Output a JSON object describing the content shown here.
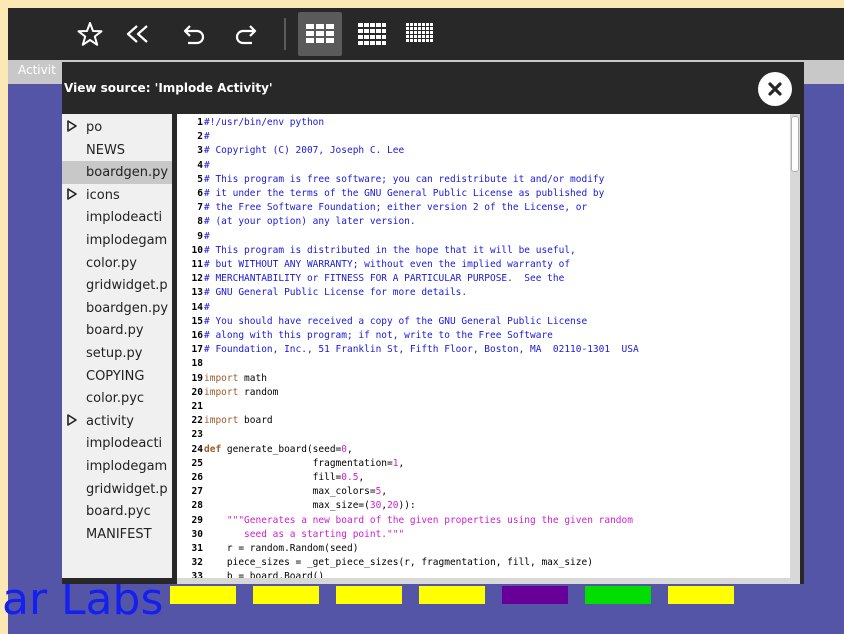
{
  "toolbar": {
    "buttons": [
      {
        "name": "star-icon",
        "label": "favorite"
      },
      {
        "name": "rewind-icon",
        "label": "rewind"
      },
      {
        "name": "undo-icon",
        "label": "undo"
      },
      {
        "name": "redo-icon",
        "label": "redo"
      },
      {
        "name": "grid-small-icon",
        "label": "small board",
        "active": true
      },
      {
        "name": "grid-medium-icon",
        "label": "medium board"
      },
      {
        "name": "grid-large-icon",
        "label": "large board"
      }
    ]
  },
  "background": {
    "activity_label": "Activit",
    "logo_text": "ar Labs",
    "tile_colors": [
      "#ffff00",
      "#ffff00",
      "#ffff00",
      "#ffff00",
      "#660099",
      "#00dd00",
      "#ffff00"
    ]
  },
  "dialog": {
    "title": "View source: 'Implode Activity'",
    "close_icon": "close-icon"
  },
  "files": [
    {
      "name": "po",
      "folder": true,
      "selected": false
    },
    {
      "name": "NEWS",
      "folder": false,
      "selected": false
    },
    {
      "name": "boardgen.py",
      "folder": false,
      "selected": true
    },
    {
      "name": "icons",
      "folder": true,
      "selected": false
    },
    {
      "name": "implodeacti",
      "folder": false,
      "selected": false
    },
    {
      "name": "implodegam",
      "folder": false,
      "selected": false
    },
    {
      "name": "color.py",
      "folder": false,
      "selected": false
    },
    {
      "name": "gridwidget.p",
      "folder": false,
      "selected": false
    },
    {
      "name": "boardgen.py",
      "folder": false,
      "selected": false
    },
    {
      "name": "board.py",
      "folder": false,
      "selected": false
    },
    {
      "name": "setup.py",
      "folder": false,
      "selected": false
    },
    {
      "name": "COPYING",
      "folder": false,
      "selected": false
    },
    {
      "name": "color.pyc",
      "folder": false,
      "selected": false
    },
    {
      "name": "activity",
      "folder": true,
      "selected": false
    },
    {
      "name": "implodeacti",
      "folder": false,
      "selected": false
    },
    {
      "name": "implodegam",
      "folder": false,
      "selected": false
    },
    {
      "name": "gridwidget.p",
      "folder": false,
      "selected": false
    },
    {
      "name": "board.pyc",
      "folder": false,
      "selected": false
    },
    {
      "name": "MANIFEST",
      "folder": false,
      "selected": false
    }
  ],
  "code": [
    {
      "n": "1",
      "s": [
        [
          "comment",
          "#!/usr/bin/env python"
        ]
      ]
    },
    {
      "n": "2",
      "s": [
        [
          "comment",
          "#"
        ]
      ]
    },
    {
      "n": "3",
      "s": [
        [
          "comment",
          "# Copyright (C) 2007, Joseph C. Lee"
        ]
      ]
    },
    {
      "n": "4",
      "s": [
        [
          "comment",
          "#"
        ]
      ]
    },
    {
      "n": "5",
      "s": [
        [
          "comment",
          "# This program is free software; you can redistribute it and/or modify"
        ]
      ]
    },
    {
      "n": "6",
      "s": [
        [
          "comment",
          "# it under the terms of the GNU General Public License as published by"
        ]
      ]
    },
    {
      "n": "7",
      "s": [
        [
          "comment",
          "# the Free Software Foundation; either version 2 of the License, or"
        ]
      ]
    },
    {
      "n": "8",
      "s": [
        [
          "comment",
          "# (at your option) any later version."
        ]
      ]
    },
    {
      "n": "9",
      "s": [
        [
          "comment",
          "#"
        ]
      ]
    },
    {
      "n": "10",
      "s": [
        [
          "comment",
          "# This program is distributed in the hope that it will be useful,"
        ]
      ]
    },
    {
      "n": "11",
      "s": [
        [
          "comment",
          "# but WITHOUT ANY WARRANTY; without even the implied warranty of"
        ]
      ]
    },
    {
      "n": "12",
      "s": [
        [
          "comment",
          "# MERCHANTABILITY or FITNESS FOR A PARTICULAR PURPOSE.  See the"
        ]
      ]
    },
    {
      "n": "13",
      "s": [
        [
          "comment",
          "# GNU General Public License for more details."
        ]
      ]
    },
    {
      "n": "14",
      "s": [
        [
          "comment",
          "#"
        ]
      ]
    },
    {
      "n": "15",
      "s": [
        [
          "comment",
          "# You should have received a copy of the GNU General Public License"
        ]
      ]
    },
    {
      "n": "16",
      "s": [
        [
          "comment",
          "# along with this program; if not, write to the Free Software"
        ]
      ]
    },
    {
      "n": "17",
      "s": [
        [
          "comment",
          "# Foundation, Inc., 51 Franklin St, Fifth Floor, Boston, MA  02110-1301  USA"
        ]
      ]
    },
    {
      "n": "18",
      "s": []
    },
    {
      "n": "19",
      "s": [
        [
          "kwl",
          "import"
        ],
        [
          "plain",
          " math"
        ]
      ]
    },
    {
      "n": "20",
      "s": [
        [
          "kwl",
          "import"
        ],
        [
          "plain",
          " random"
        ]
      ]
    },
    {
      "n": "21",
      "s": []
    },
    {
      "n": "22",
      "s": [
        [
          "kwl",
          "import"
        ],
        [
          "plain",
          " board"
        ]
      ]
    },
    {
      "n": "23",
      "s": []
    },
    {
      "n": "24",
      "s": [
        [
          "kw",
          "def"
        ],
        [
          "plain",
          " generate_board(seed="
        ],
        [
          "num",
          "0"
        ],
        [
          "plain",
          ","
        ]
      ]
    },
    {
      "n": "25",
      "s": [
        [
          "plain",
          "                   fragmentation="
        ],
        [
          "num",
          "1"
        ],
        [
          "plain",
          ","
        ]
      ]
    },
    {
      "n": "26",
      "s": [
        [
          "plain",
          "                   fill="
        ],
        [
          "num",
          "0.5"
        ],
        [
          "plain",
          ","
        ]
      ]
    },
    {
      "n": "27",
      "s": [
        [
          "plain",
          "                   max_colors="
        ],
        [
          "num",
          "5"
        ],
        [
          "plain",
          ","
        ]
      ]
    },
    {
      "n": "28",
      "s": [
        [
          "plain",
          "                   max_size=("
        ],
        [
          "num",
          "30"
        ],
        [
          "plain",
          ","
        ],
        [
          "num",
          "20"
        ],
        [
          "plain",
          ")):"
        ]
      ]
    },
    {
      "n": "29",
      "s": [
        [
          "str",
          "    \"\"\"Generates a new board of the given properties using the given random"
        ]
      ]
    },
    {
      "n": "30",
      "s": [
        [
          "str",
          "       seed as a starting point.\"\"\""
        ]
      ]
    },
    {
      "n": "31",
      "s": [
        [
          "plain",
          "    r = random.Random(seed)"
        ]
      ]
    },
    {
      "n": "32",
      "s": [
        [
          "plain",
          "    piece_sizes = _get_piece_sizes(r, fragmentation, fill, max_size)"
        ]
      ]
    },
    {
      "n": "33",
      "s": [
        [
          "plain",
          "    b = board.Board()"
        ]
      ]
    }
  ]
}
